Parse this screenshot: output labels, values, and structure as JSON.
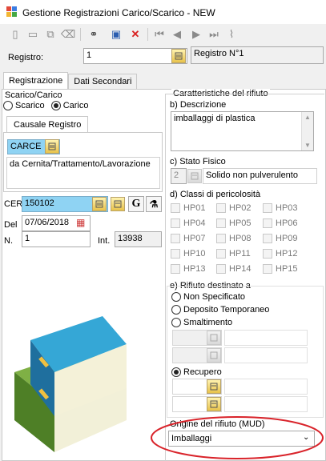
{
  "window": {
    "title": "Gestione Registrazioni Carico/Scarico - NEW"
  },
  "toolbar": {
    "icons": [
      "new-icon",
      "folder-icon",
      "copy-icon",
      "eraser-icon",
      "binoculars-icon",
      "save-icon",
      "delete-icon",
      "first-icon",
      "prev-icon",
      "next-icon",
      "last-icon",
      "attach-icon"
    ]
  },
  "registro": {
    "label": "Registro:",
    "value": "1",
    "display": "Registro N°1"
  },
  "tabs": {
    "main": [
      "Registrazione",
      "Dati Secondari"
    ]
  },
  "scarico_carico": {
    "group": "Scarico/Carico",
    "scarico": "Scarico",
    "carico": "Carico",
    "selected": "Carico"
  },
  "causale": {
    "tab": "Causale Registro",
    "code": "CARCE",
    "description": "da Cernita/Trattamento/Lavorazione"
  },
  "cer": {
    "label": "CER",
    "value": "150102"
  },
  "del": {
    "label": "Del",
    "value": "07/06/2018"
  },
  "numero": {
    "label": "N.",
    "value": "1",
    "int_label": "Int.",
    "int_value": "13938"
  },
  "caratteristiche": {
    "group": "Caratteristiche del rifiuto",
    "descrizione_label": "b) Descrizione",
    "descrizione_value": "imballaggi di plastica",
    "stato_label": "c) Stato Fisico",
    "stato_code": "2",
    "stato_value": "Solido non pulverulento",
    "classi_label": "d) Classi di pericolosità",
    "classi": [
      "HP01",
      "HP02",
      "HP03",
      "HP04",
      "HP05",
      "HP06",
      "HP07",
      "HP08",
      "HP09",
      "HP10",
      "HP11",
      "HP12",
      "HP13",
      "HP14",
      "HP15"
    ]
  },
  "destinazione": {
    "label": "e) Rifiuto destinato a",
    "non_specificato": "Non Specificato",
    "deposito": "Deposito Temporaneo",
    "smaltimento": "Smaltimento",
    "recupero": "Recupero",
    "selected": "Recupero"
  },
  "origine": {
    "label": "Origine del rifiuto (MUD)",
    "value": "Imballaggi"
  },
  "accent": {
    "highlight_ellipse": "#d9232a",
    "cer_bg": "#8fd3f3"
  }
}
